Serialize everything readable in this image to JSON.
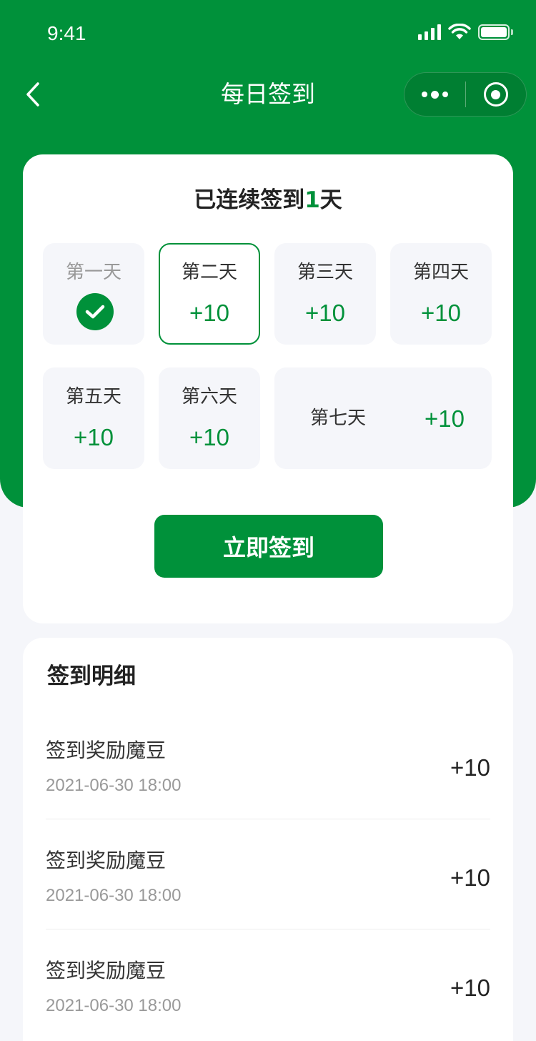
{
  "status_bar": {
    "time": "9:41"
  },
  "nav": {
    "title": "每日签到"
  },
  "signin": {
    "streak_prefix": "已连续签到",
    "streak_days": "1",
    "streak_suffix": "天",
    "days": [
      {
        "label": "第一天",
        "reward": "",
        "state": "done"
      },
      {
        "label": "第二天",
        "reward": "+10",
        "state": "active"
      },
      {
        "label": "第三天",
        "reward": "+10",
        "state": "pending"
      },
      {
        "label": "第四天",
        "reward": "+10",
        "state": "pending"
      },
      {
        "label": "第五天",
        "reward": "+10",
        "state": "pending"
      },
      {
        "label": "第六天",
        "reward": "+10",
        "state": "pending"
      },
      {
        "label": "第七天",
        "reward": "+10",
        "state": "pending"
      }
    ],
    "button_label": "立即签到"
  },
  "details": {
    "title": "签到明细",
    "items": [
      {
        "title": "签到奖励魔豆",
        "time": "2021-06-30 18:00",
        "amount": "+10"
      },
      {
        "title": "签到奖励魔豆",
        "time": "2021-06-30 18:00",
        "amount": "+10"
      },
      {
        "title": "签到奖励魔豆",
        "time": "2021-06-30 18:00",
        "amount": "+10"
      }
    ]
  },
  "colors": {
    "brand_green": "#00913a",
    "page_bg": "#f5f6fa"
  },
  "icons": [
    "back-arrow-icon",
    "more-dots-icon",
    "close-circle-icon",
    "check-icon",
    "signal-icon",
    "wifi-icon",
    "battery-icon"
  ]
}
